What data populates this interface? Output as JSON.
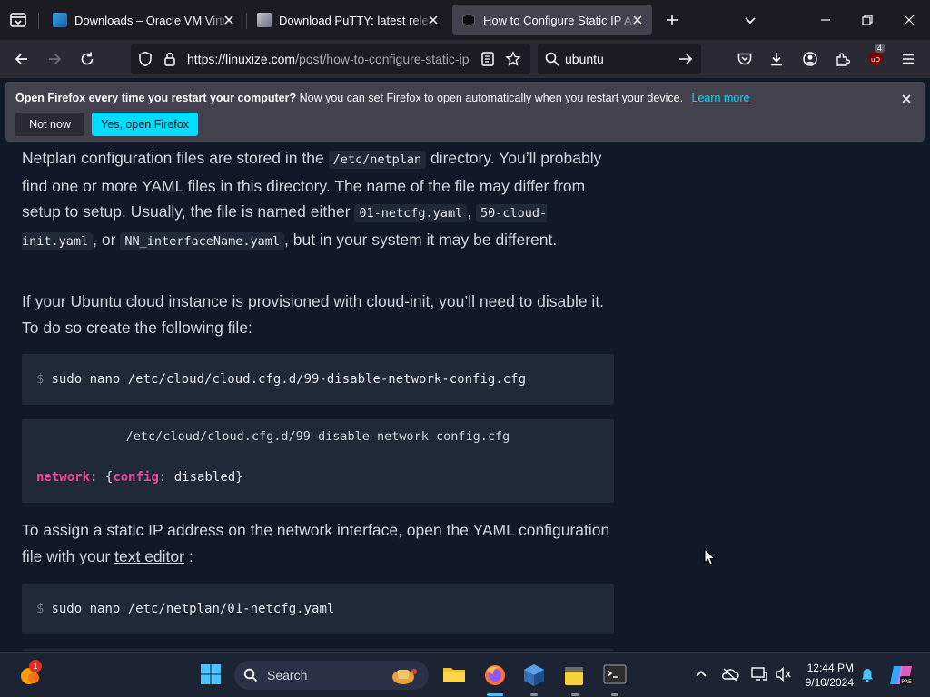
{
  "browser": {
    "tabs": [
      {
        "title": "Downloads – Oracle VM VirtualBox",
        "favicon": "virtualbox-icon",
        "active": false
      },
      {
        "title": "Download PuTTY: latest release",
        "favicon": "putty-icon",
        "active": false
      },
      {
        "title": "How to Configure Static IP Address",
        "favicon": "linuxize-icon",
        "active": true
      }
    ],
    "url": {
      "host": "https://linuxize.com",
      "rest": "/post/how-to-configure-static-ip"
    },
    "search_query": "ubuntu",
    "extension_badge": "4"
  },
  "notification": {
    "bold": "Open Firefox every time you restart your computer?",
    "text": "Now you can set Firefox to open automatically when you restart your device.",
    "learn_more": "Learn more",
    "not_now": "Not now",
    "yes": "Yes, open Firefox"
  },
  "article": {
    "para1": {
      "t1": "Netplan configuration files are stored in the ",
      "c1": "/etc/netplan",
      "t2": " directory. You’ll probably find one or more YAML files in this directory. The name of the file may differ from setup to setup. Usually, the file is named either ",
      "c2": "01-netcfg.yaml",
      "t3": ", ",
      "c3": "50-cloud-init.yaml",
      "t4": ", or ",
      "c4": "NN_interfaceName.yaml",
      "t5": ", but in your system it may be different."
    },
    "para2": "If your Ubuntu cloud instance is provisioned with cloud-init, you’ll need to disable it. To do so create the following file:",
    "cmd1": {
      "prompt": "$",
      "command": "sudo nano /etc/cloud/cloud.cfg.d/99-disable-network-config.cfg"
    },
    "file1": {
      "filename": "/etc/cloud/cloud.cfg.d/99-disable-network-config.cfg",
      "k1": "network",
      "p1": ": {",
      "k2": "config",
      "p2": ": disabled}"
    },
    "para3": {
      "t1": "To assign a static IP address on the network interface, open the YAML configuration file with your ",
      "link": "text editor",
      "t2": " :"
    },
    "cmd2": {
      "prompt": "$",
      "command": "sudo nano /etc/netplan/01-netcfg.yaml"
    }
  },
  "taskbar": {
    "search_label": "Search",
    "weather_badge": "1",
    "time": "12:44 PM",
    "date": "9/10/2024"
  },
  "colors": {
    "accent": "#00ddff",
    "pink_key": "#ec4899",
    "page_bg": "#111827",
    "code_bg": "#1f2937"
  }
}
